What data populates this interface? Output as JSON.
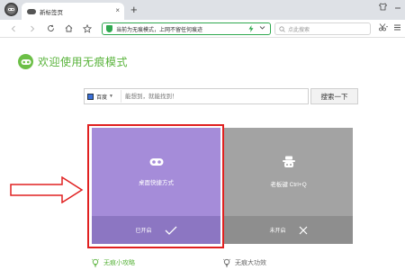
{
  "browser": {
    "tab_title": "新标签页",
    "tab_close": "×",
    "new_tab": "+",
    "address_text": "当前为无痕模式，上网不留任何痕迹",
    "search_placeholder": "点此搜索"
  },
  "page": {
    "heading": "欢迎使用无痕模式",
    "search": {
      "engine": "百度",
      "placeholder": "能想到，就能找到！",
      "button": "搜索一下"
    },
    "cards": [
      {
        "label": "桌面快捷方式",
        "status": "已开启",
        "state": "on"
      },
      {
        "label": "老板键 Ctrl+Q",
        "status": "未开启",
        "state": "off"
      }
    ],
    "tips": [
      {
        "text": "无痕小攻略",
        "color": "#59b33b"
      },
      {
        "text": "无痕大功效",
        "color": "#666666"
      }
    ]
  },
  "colors": {
    "brand_green": "#59b33b",
    "card_purple": "#a58cd9",
    "card_gray": "#a3a3a3",
    "highlight_red": "#e02020"
  }
}
